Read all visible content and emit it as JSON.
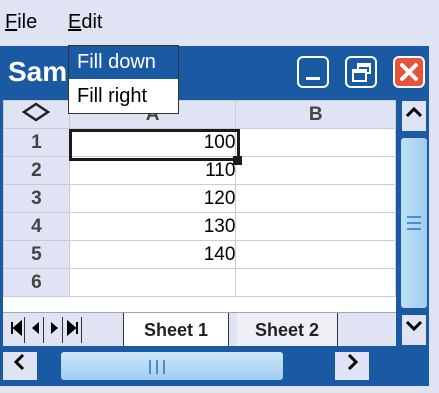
{
  "menubar": {
    "file": "File",
    "edit": "Edit"
  },
  "window": {
    "title": "Samples"
  },
  "sheet": {
    "corner_icon": "diamond-outline-icon",
    "columns": [
      "A",
      "B"
    ],
    "rows": [
      {
        "num": "1",
        "a": "100",
        "b": ""
      },
      {
        "num": "2",
        "a": "110",
        "b": ""
      },
      {
        "num": "3",
        "a": "120",
        "b": ""
      },
      {
        "num": "4",
        "a": "130",
        "b": ""
      },
      {
        "num": "5",
        "a": "140",
        "b": ""
      },
      {
        "num": "6",
        "a": "",
        "b": ""
      }
    ],
    "selected_cell": "A1"
  },
  "tabs": [
    "Sheet 1",
    "Sheet 2"
  ],
  "edit_menu": {
    "items": [
      "Fill down",
      "Fill right"
    ],
    "highlighted": "Fill down"
  },
  "colors": {
    "window_blue": "#1a5aa3",
    "menu_bg": "#dfe3f4",
    "close_red": "#e8543a"
  }
}
